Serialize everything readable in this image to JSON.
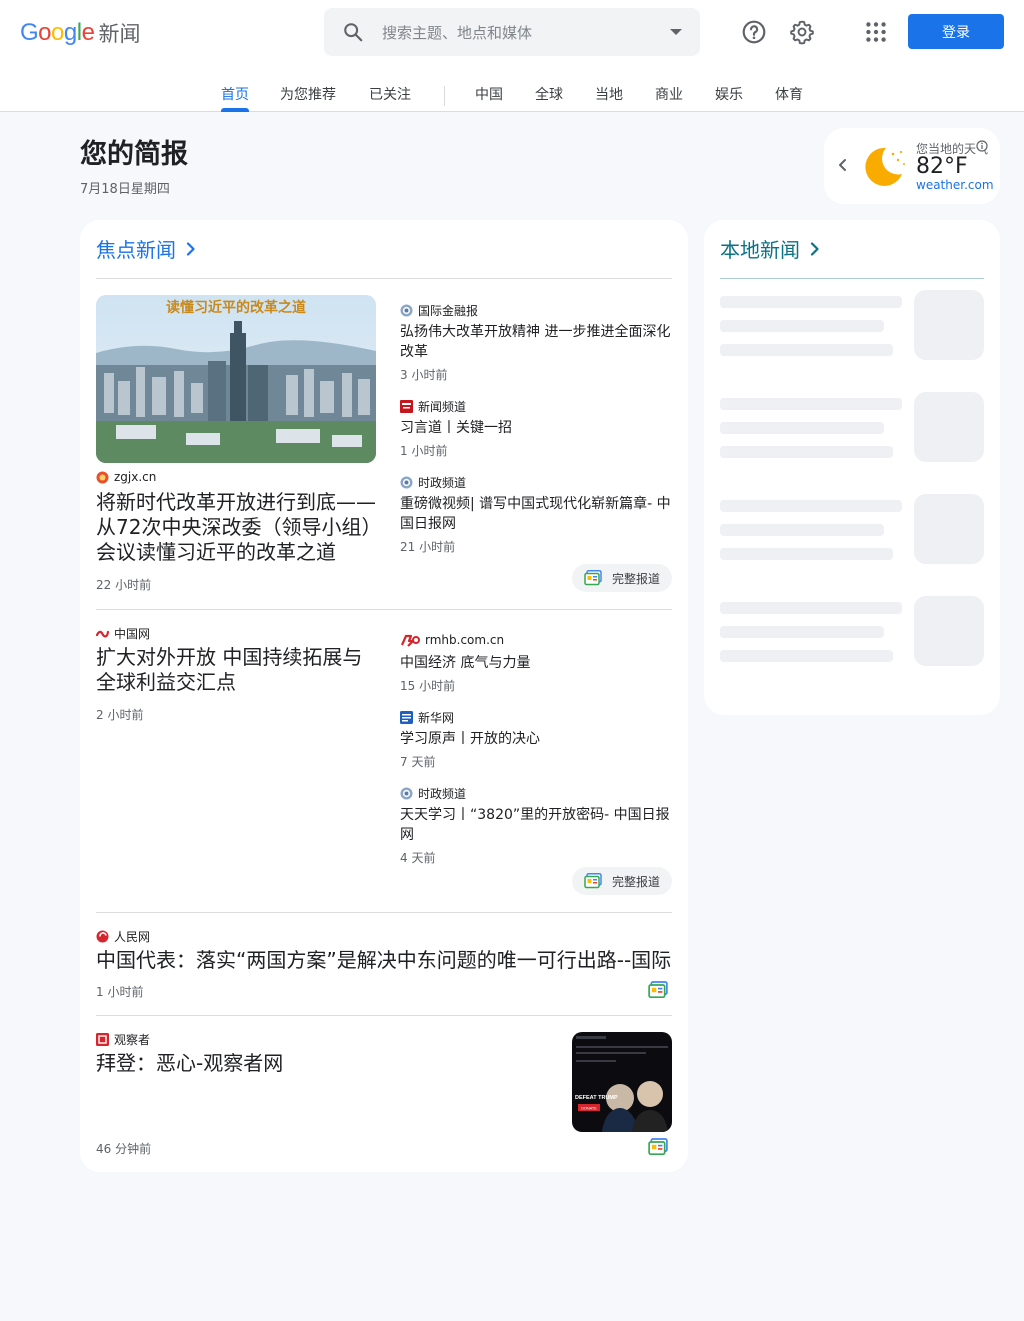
{
  "header": {
    "logo_google": "Google",
    "logo_news": "新闻",
    "search_placeholder": "搜索主题、地点和媒体",
    "login_label": "登录"
  },
  "nav": {
    "items": [
      "首页",
      "为您推荐",
      "已关注",
      "中国",
      "全球",
      "当地",
      "商业",
      "娱乐",
      "体育"
    ],
    "active": "首页"
  },
  "briefing": {
    "title": "您的简报",
    "date": "7月18日星期四"
  },
  "weather": {
    "title": "您当地的天气",
    "temp": "82°F",
    "source": "weather.com",
    "condition_icon": "moon-icon"
  },
  "top_stories": {
    "heading": "焦点新闻",
    "story1": {
      "image_text": "读懂习近平的改革之道",
      "source": "zgjx.cn",
      "title": "将新时代改革开放进行到底——从72次中央深改委（领导小组）会议读懂习近平的改革之道",
      "time": "22 小时前",
      "related": [
        {
          "source": "国际金融报",
          "title": "弘扬伟大改革开放精神 进一步推进全面深化改革",
          "time": "3 小时前"
        },
        {
          "source": "新闻频道",
          "title": "习言道丨关键一招",
          "time": "1 小时前"
        },
        {
          "source": "时政频道",
          "title": "重磅微视频| 谱写中国式现代化崭新篇章- 中国日报网",
          "time": "21 小时前"
        }
      ],
      "full_coverage": "完整报道"
    },
    "story2": {
      "source": "中国网",
      "title": "扩大对外开放 中国持续拓展与全球利益交汇点",
      "time": "2 小时前",
      "related": [
        {
          "source": "rmhb.com.cn",
          "title": "中国经济 底气与力量",
          "time": "15 小时前"
        },
        {
          "source": "新华网",
          "title": "学习原声丨开放的决心",
          "time": "7 天前"
        },
        {
          "source": "时政频道",
          "title": "天天学习丨“3820”里的开放密码- 中国日报网",
          "time": "4 天前"
        }
      ],
      "full_coverage": "完整报道"
    },
    "story3": {
      "source": "人民网",
      "title": "中国代表：落实“两国方案”是解决中东问题的唯一可行出路--国际",
      "time": "1 小时前"
    },
    "story4": {
      "source": "观察者",
      "title": "拜登：恶心-观察者网",
      "time": "46 分钟前",
      "thumb_text": "DEFEAT TRUMP",
      "thumb_button": "DONATE"
    }
  },
  "local_news": {
    "heading": "本地新闻"
  },
  "colors": {
    "accent": "#1a73e8",
    "local_heading": "#0b7285",
    "moon": "#f9ab00"
  }
}
